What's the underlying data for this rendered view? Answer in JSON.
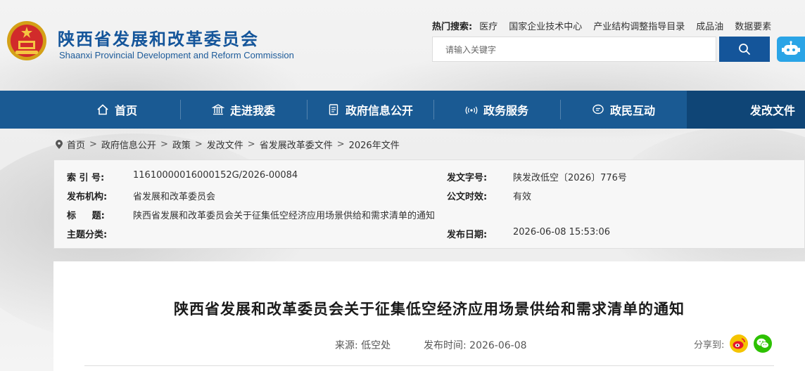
{
  "colors": {
    "brand_blue": "#14559a",
    "nav_bg": "#1a5a93",
    "nav_active_bg": "#0f4576",
    "robot_bg": "#2aa4e6",
    "weibo": "#e6162d",
    "wechat": "#2dc100"
  },
  "header": {
    "title": "陕西省发展和改革委员会",
    "subtitle": "Shaanxi Provincial Development and Reform Commission",
    "emblem_icon": "national-emblem-icon"
  },
  "hot_search": {
    "label": "热门搜索:",
    "items": [
      "医疗",
      "国家企业技术中心",
      "产业结构调整指导目录",
      "成品油",
      "数据要素"
    ]
  },
  "search": {
    "placeholder": "请输入关键字",
    "button_icon": "search-icon",
    "assistant_icon": "robot-icon"
  },
  "nav": {
    "items": [
      {
        "label": "首页",
        "icon": "home-icon"
      },
      {
        "label": "走进我委",
        "icon": "building-icon"
      },
      {
        "label": "政府信息公开",
        "icon": "document-icon"
      },
      {
        "label": "政务服务",
        "icon": "signal-icon"
      },
      {
        "label": "政民互动",
        "icon": "chat-icon"
      },
      {
        "label": "发改文件",
        "icon": ""
      }
    ],
    "active": "发改文件"
  },
  "breadcrumb": {
    "icon": "location-pin-icon",
    "items": [
      "首页",
      "政府信息公开",
      "政策",
      "发改文件",
      "省发展改革委文件",
      "2026年文件"
    ],
    "separator": ">"
  },
  "info": {
    "index_label": "索 引 号:",
    "index_value": "11610000016000152G/2026-00084",
    "doc_no_label": "发文字号:",
    "doc_no_value": "陕发改低空〔2026〕776号",
    "publisher_label": "发布机构:",
    "publisher_value": "省发展和改革委员会",
    "validity_label": "公文时效:",
    "validity_value": "有效",
    "title_label": "标     题:",
    "title_value": "陕西省发展和改革委员会关于征集低空经济应用场景供给和需求清单的通知",
    "topic_label": "主题分类:",
    "topic_value": "",
    "date_label": "发布日期:",
    "date_value": "2026-06-08 15:53:06"
  },
  "article": {
    "title": "陕西省发展和改革委员会关于征集低空经济应用场景供给和需求清单的通知",
    "source": "来源:  低空处",
    "publish_time": "发布时间:  2026-06-08",
    "share_label": "分享到:",
    "share_icons": [
      "weibo-icon",
      "wechat-icon"
    ]
  }
}
